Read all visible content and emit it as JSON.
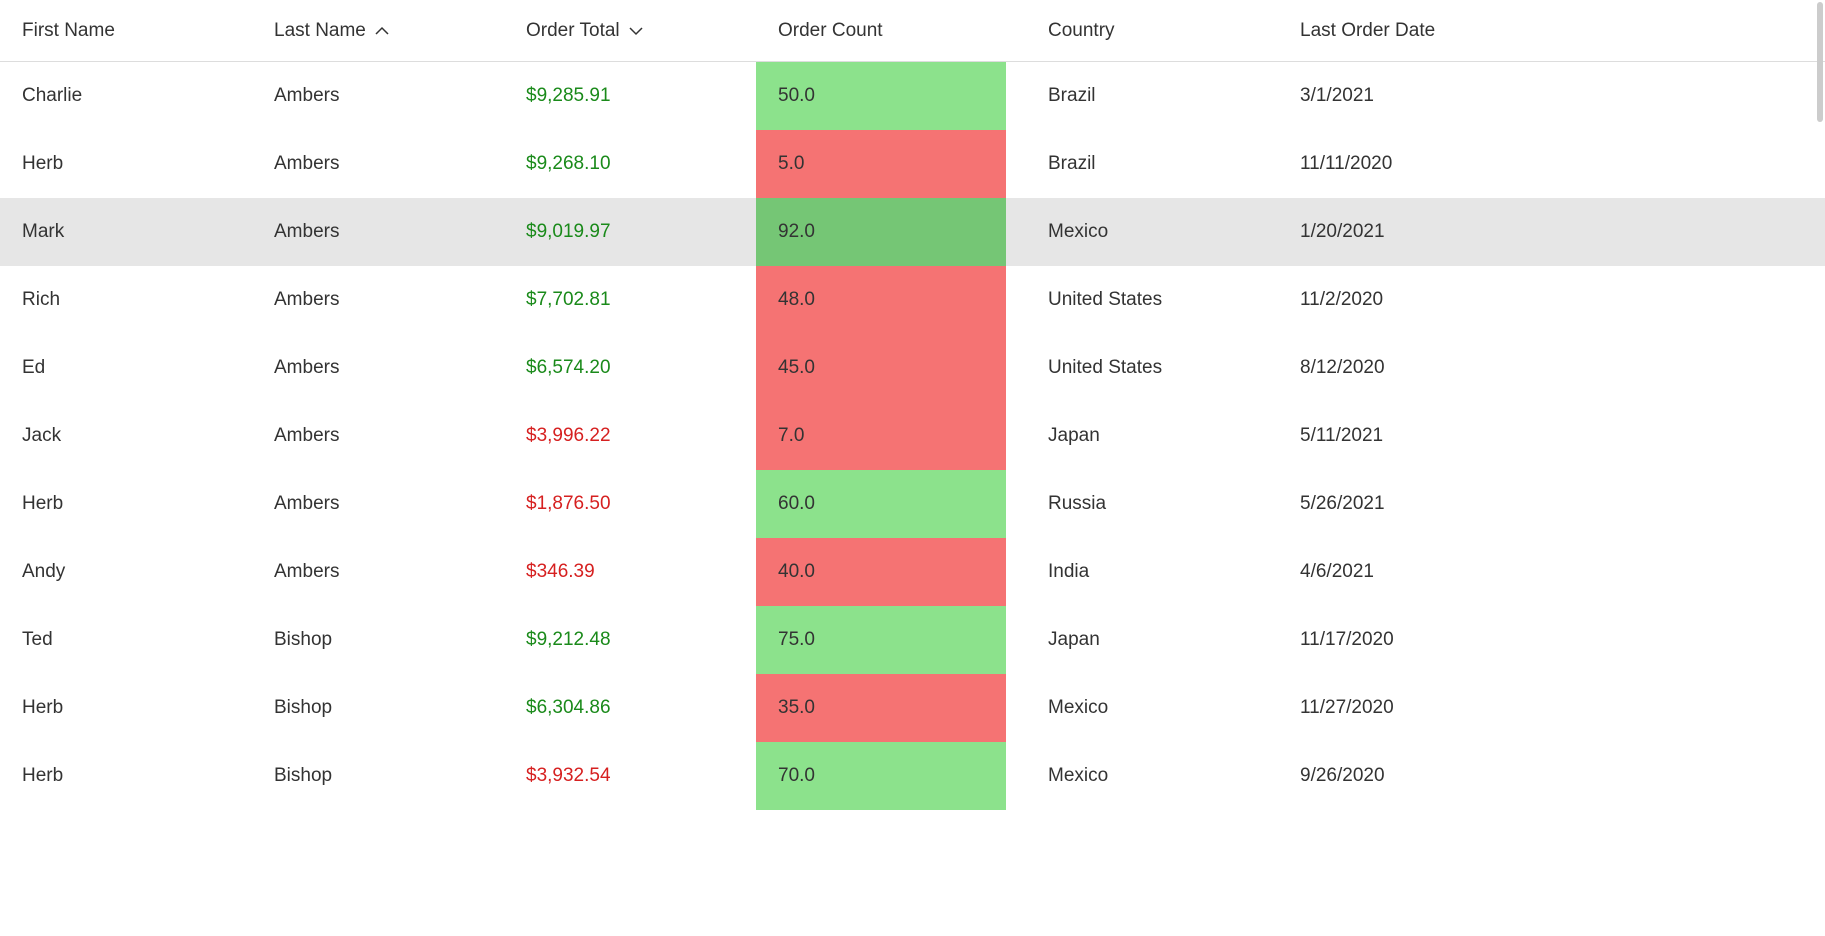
{
  "table": {
    "headers": {
      "first_name": "First Name",
      "last_name": "Last Name",
      "order_total": "Order Total",
      "order_count": "Order Count",
      "country": "Country",
      "last_order": "Last Order Date"
    },
    "sort": {
      "last_name": "asc",
      "order_total": "desc"
    },
    "thresholds": {
      "order_total_green_min": 5000,
      "order_count_green_min": 50
    },
    "colors": {
      "text_green": "#1a8a1a",
      "text_red": "#d62020",
      "bg_green": "#8ce28c",
      "bg_red": "#f57373",
      "row_selected": "#e6e6e6"
    },
    "selected_index": 2,
    "rows": [
      {
        "first_name": "Charlie",
        "last_name": "Ambers",
        "order_total": "$9,285.91",
        "order_total_val": 9285.91,
        "order_count": "50.0",
        "order_count_val": 50,
        "country": "Brazil",
        "last_order": "3/1/2021"
      },
      {
        "first_name": "Herb",
        "last_name": "Ambers",
        "order_total": "$9,268.10",
        "order_total_val": 9268.1,
        "order_count": "5.0",
        "order_count_val": 5,
        "country": "Brazil",
        "last_order": "11/11/2020"
      },
      {
        "first_name": "Mark",
        "last_name": "Ambers",
        "order_total": "$9,019.97",
        "order_total_val": 9019.97,
        "order_count": "92.0",
        "order_count_val": 92,
        "country": "Mexico",
        "last_order": "1/20/2021"
      },
      {
        "first_name": "Rich",
        "last_name": "Ambers",
        "order_total": "$7,702.81",
        "order_total_val": 7702.81,
        "order_count": "48.0",
        "order_count_val": 48,
        "country": "United States",
        "last_order": "11/2/2020"
      },
      {
        "first_name": "Ed",
        "last_name": "Ambers",
        "order_total": "$6,574.20",
        "order_total_val": 6574.2,
        "order_count": "45.0",
        "order_count_val": 45,
        "country": "United States",
        "last_order": "8/12/2020"
      },
      {
        "first_name": "Jack",
        "last_name": "Ambers",
        "order_total": "$3,996.22",
        "order_total_val": 3996.22,
        "order_count": "7.0",
        "order_count_val": 7,
        "country": "Japan",
        "last_order": "5/11/2021"
      },
      {
        "first_name": "Herb",
        "last_name": "Ambers",
        "order_total": "$1,876.50",
        "order_total_val": 1876.5,
        "order_count": "60.0",
        "order_count_val": 60,
        "country": "Russia",
        "last_order": "5/26/2021"
      },
      {
        "first_name": "Andy",
        "last_name": "Ambers",
        "order_total": "$346.39",
        "order_total_val": 346.39,
        "order_count": "40.0",
        "order_count_val": 40,
        "country": "India",
        "last_order": "4/6/2021"
      },
      {
        "first_name": "Ted",
        "last_name": "Bishop",
        "order_total": "$9,212.48",
        "order_total_val": 9212.48,
        "order_count": "75.0",
        "order_count_val": 75,
        "country": "Japan",
        "last_order": "11/17/2020"
      },
      {
        "first_name": "Herb",
        "last_name": "Bishop",
        "order_total": "$6,304.86",
        "order_total_val": 6304.86,
        "order_count": "35.0",
        "order_count_val": 35,
        "country": "Mexico",
        "last_order": "11/27/2020"
      },
      {
        "first_name": "Herb",
        "last_name": "Bishop",
        "order_total": "$3,932.54",
        "order_total_val": 3932.54,
        "order_count": "70.0",
        "order_count_val": 70,
        "country": "Mexico",
        "last_order": "9/26/2020"
      }
    ]
  }
}
